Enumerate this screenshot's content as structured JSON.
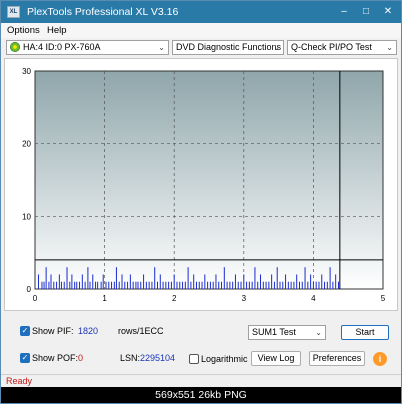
{
  "window": {
    "title": "PlexTools Professional XL V3.16",
    "icon_text": "XL"
  },
  "menu": {
    "options": "Options",
    "help": "Help"
  },
  "toolbar": {
    "drive": "HA:4 ID:0  PX-760A",
    "function": "DVD Diagnostic Functions",
    "test": "Q-Check PI/PO Test"
  },
  "chart_data": {
    "type": "bar",
    "x_ticks": [
      "0",
      "1",
      "2",
      "3",
      "4",
      "5"
    ],
    "y_ticks": [
      "0",
      "10",
      "20",
      "30"
    ],
    "xlim": [
      0,
      5
    ],
    "ylim": [
      0,
      30
    ],
    "threshold": 4,
    "scan_end": 4.38,
    "grid": true,
    "background_gradient": [
      "#8fa6ab",
      "#ffffff"
    ],
    "bar_color": "#1a2ccc",
    "x": [
      0.05,
      0.1,
      0.13,
      0.16,
      0.2,
      0.23,
      0.27,
      0.31,
      0.35,
      0.38,
      0.42,
      0.46,
      0.5,
      0.53,
      0.57,
      0.6,
      0.64,
      0.68,
      0.72,
      0.76,
      0.79,
      0.83,
      0.87,
      0.9,
      0.95,
      0.98,
      1.02,
      1.06,
      1.1,
      1.14,
      1.17,
      1.21,
      1.25,
      1.29,
      1.33,
      1.37,
      1.41,
      1.45,
      1.48,
      1.52,
      1.56,
      1.6,
      1.64,
      1.68,
      1.72,
      1.76,
      1.8,
      1.84,
      1.88,
      1.92,
      1.96,
      2.0,
      2.04,
      2.08,
      2.12,
      2.16,
      2.2,
      2.24,
      2.28,
      2.32,
      2.36,
      2.4,
      2.44,
      2.48,
      2.52,
      2.56,
      2.6,
      2.64,
      2.68,
      2.72,
      2.76,
      2.8,
      2.84,
      2.88,
      2.92,
      2.96,
      3.0,
      3.04,
      3.08,
      3.12,
      3.16,
      3.2,
      3.24,
      3.28,
      3.32,
      3.36,
      3.4,
      3.44,
      3.48,
      3.52,
      3.56,
      3.6,
      3.64,
      3.68,
      3.72,
      3.76,
      3.8,
      3.84,
      3.88,
      3.92,
      3.96,
      4.0,
      4.04,
      4.08,
      4.12,
      4.16,
      4.2,
      4.24,
      4.28,
      4.32,
      4.36
    ],
    "values": [
      2,
      1,
      1,
      3,
      1,
      2,
      1,
      1,
      2,
      1,
      1,
      3,
      1,
      2,
      1,
      1,
      1,
      2,
      1,
      3,
      1,
      2,
      1,
      1,
      1,
      2,
      1,
      1,
      1,
      1,
      3,
      1,
      2,
      1,
      1,
      2,
      1,
      1,
      1,
      1,
      2,
      1,
      1,
      1,
      3,
      1,
      2,
      1,
      1,
      1,
      1,
      2,
      1,
      1,
      1,
      1,
      3,
      1,
      2,
      1,
      1,
      1,
      2,
      1,
      1,
      1,
      2,
      1,
      1,
      3,
      1,
      1,
      1,
      2,
      1,
      1,
      2,
      1,
      1,
      1,
      3,
      1,
      2,
      1,
      1,
      1,
      2,
      1,
      3,
      1,
      1,
      2,
      1,
      1,
      1,
      2,
      1,
      1,
      3,
      1,
      2,
      1,
      1,
      1,
      2,
      1,
      1,
      3,
      1,
      2,
      1
    ]
  },
  "bottom": {
    "show_pif": "Show PIF:",
    "pif_value": "1820",
    "rows_label": "rows/1ECC",
    "show_pof": "Show POF:",
    "pof_value": "0",
    "lsn_label": "LSN:",
    "lsn_value": "2295104",
    "logarithmic": "Logarithmic",
    "sum_test": "SUM1 Test",
    "start": "Start",
    "view_log": "View Log",
    "preferences": "Preferences",
    "info": "i"
  },
  "status": {
    "text": "Ready"
  },
  "caption": {
    "text": "569x551  26kb  PNG"
  }
}
